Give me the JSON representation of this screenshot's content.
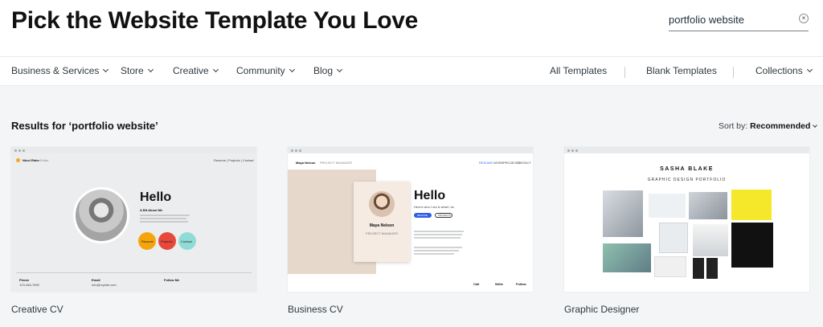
{
  "header": {
    "title": "Pick the Website Template You Love",
    "search": {
      "value": "portfolio website",
      "clear_icon": "×"
    }
  },
  "nav": {
    "left": [
      "Business & Services",
      "Store",
      "Creative",
      "Community",
      "Blog"
    ],
    "right": [
      "All Templates",
      "Blank Templates",
      "Collections"
    ]
  },
  "results": {
    "title": "Results for ‘portfolio website’",
    "sort_label": "Sort by:",
    "sort_value": "Recommended"
  },
  "cards": [
    {
      "label": "Creative CV",
      "preview": {
        "brand": "Nicol Rider",
        "brand_suffix": "Editor",
        "nav": "Resume | Projects | Contact",
        "hello": "Hello",
        "about": "A Bit About Me",
        "bubbles": [
          "Resume",
          "Projects",
          "Contact"
        ],
        "footer": [
          "Phone",
          "Email",
          "Follow Me"
        ],
        "phone": "123-456-7890",
        "email": "info@mysite.com"
      }
    },
    {
      "label": "Business CV",
      "preview": {
        "brand": "Maya Nelson",
        "brand_role": "PROJECT MANAGER",
        "nav": [
          "RESUME",
          "WORK",
          "PROJECTS",
          "CONTACT"
        ],
        "hello": "Hello",
        "tagline": "Here's who I am & what I do",
        "profile_name": "Maya Nelson",
        "profile_role": "PROJECT MANAGER",
        "buttons": [
          "RESUME",
          "PROJECTS"
        ],
        "footer": [
          "Call",
          "Write",
          "Follow"
        ],
        "phone": "123-456-7890",
        "email": "info@mysite.com"
      }
    },
    {
      "label": "Graphic Designer",
      "preview": {
        "name": "SASHA BLAKE",
        "subtitle": "GRAPHIC DESIGN PORTFOLIO"
      }
    }
  ],
  "colors": {
    "bubble_resume": "#f5a40c",
    "bubble_projects": "#e8473b",
    "bubble_contact": "#8fdcd6",
    "beige": "#e7d8cc",
    "yellow": "#f5e82a"
  }
}
